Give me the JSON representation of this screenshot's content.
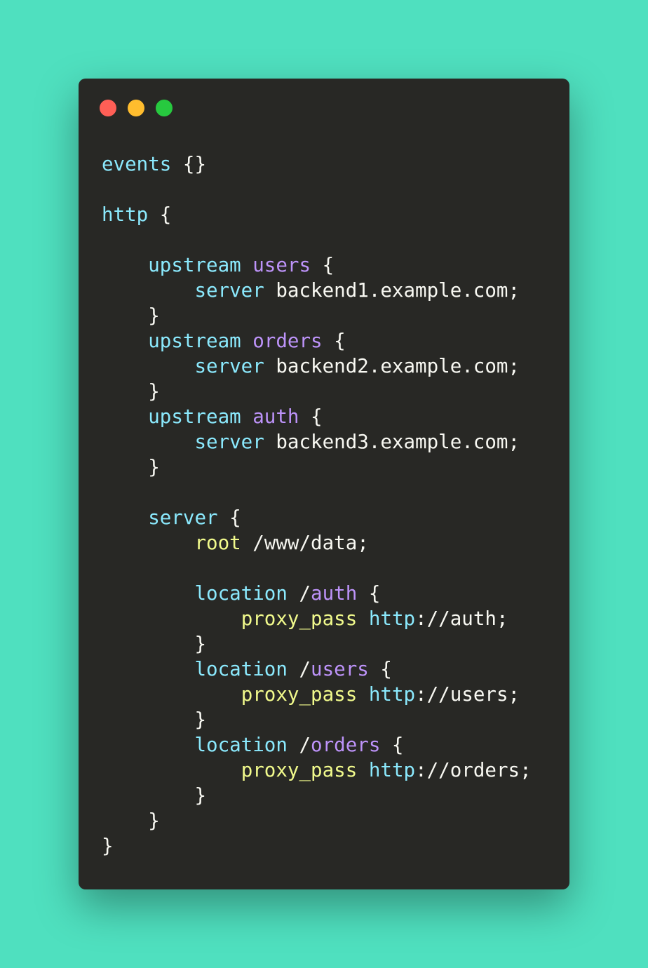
{
  "window": {
    "controls": [
      {
        "name": "close",
        "color": "#ff5f56"
      },
      {
        "name": "minimize",
        "color": "#ffbd2e"
      },
      {
        "name": "maximize",
        "color": "#27c93f"
      }
    ]
  },
  "colors": {
    "background": "#4fe0bf",
    "editor": "#282825",
    "keyword": "#8be9fd",
    "name": "#bd93f9",
    "directive": "#f1fa8c",
    "text": "#f8f8f2"
  },
  "code": {
    "language": "nginx",
    "lines": [
      [
        {
          "t": "events",
          "c": "kw"
        },
        {
          "t": " {}",
          "c": "tx"
        }
      ],
      [],
      [
        {
          "t": "http",
          "c": "kw"
        },
        {
          "t": " {",
          "c": "tx"
        }
      ],
      [],
      [
        {
          "t": "    ",
          "c": "tx"
        },
        {
          "t": "upstream",
          "c": "kw"
        },
        {
          "t": " ",
          "c": "tx"
        },
        {
          "t": "users",
          "c": "nm"
        },
        {
          "t": " {",
          "c": "tx"
        }
      ],
      [
        {
          "t": "        ",
          "c": "tx"
        },
        {
          "t": "server",
          "c": "kw"
        },
        {
          "t": " backend1.example.com;",
          "c": "tx"
        }
      ],
      [
        {
          "t": "    }",
          "c": "tx"
        }
      ],
      [
        {
          "t": "    ",
          "c": "tx"
        },
        {
          "t": "upstream",
          "c": "kw"
        },
        {
          "t": " ",
          "c": "tx"
        },
        {
          "t": "orders",
          "c": "nm"
        },
        {
          "t": " {",
          "c": "tx"
        }
      ],
      [
        {
          "t": "        ",
          "c": "tx"
        },
        {
          "t": "server",
          "c": "kw"
        },
        {
          "t": " backend2.example.com;",
          "c": "tx"
        }
      ],
      [
        {
          "t": "    }",
          "c": "tx"
        }
      ],
      [
        {
          "t": "    ",
          "c": "tx"
        },
        {
          "t": "upstream",
          "c": "kw"
        },
        {
          "t": " ",
          "c": "tx"
        },
        {
          "t": "auth",
          "c": "nm"
        },
        {
          "t": " {",
          "c": "tx"
        }
      ],
      [
        {
          "t": "        ",
          "c": "tx"
        },
        {
          "t": "server",
          "c": "kw"
        },
        {
          "t": " backend3.example.com;",
          "c": "tx"
        }
      ],
      [
        {
          "t": "    }",
          "c": "tx"
        }
      ],
      [],
      [
        {
          "t": "    ",
          "c": "tx"
        },
        {
          "t": "server",
          "c": "kw"
        },
        {
          "t": " {",
          "c": "tx"
        }
      ],
      [
        {
          "t": "        ",
          "c": "tx"
        },
        {
          "t": "root",
          "c": "fn"
        },
        {
          "t": " /www/data;",
          "c": "tx"
        }
      ],
      [],
      [
        {
          "t": "        ",
          "c": "tx"
        },
        {
          "t": "location",
          "c": "kw"
        },
        {
          "t": " /",
          "c": "tx"
        },
        {
          "t": "auth",
          "c": "nm"
        },
        {
          "t": " {",
          "c": "tx"
        }
      ],
      [
        {
          "t": "            ",
          "c": "tx"
        },
        {
          "t": "proxy_pass",
          "c": "fn"
        },
        {
          "t": " ",
          "c": "tx"
        },
        {
          "t": "http",
          "c": "kw"
        },
        {
          "t": "://auth;",
          "c": "tx"
        }
      ],
      [
        {
          "t": "        }",
          "c": "tx"
        }
      ],
      [
        {
          "t": "        ",
          "c": "tx"
        },
        {
          "t": "location",
          "c": "kw"
        },
        {
          "t": " /",
          "c": "tx"
        },
        {
          "t": "users",
          "c": "nm"
        },
        {
          "t": " {",
          "c": "tx"
        }
      ],
      [
        {
          "t": "            ",
          "c": "tx"
        },
        {
          "t": "proxy_pass",
          "c": "fn"
        },
        {
          "t": " ",
          "c": "tx"
        },
        {
          "t": "http",
          "c": "kw"
        },
        {
          "t": "://users;",
          "c": "tx"
        }
      ],
      [
        {
          "t": "        }",
          "c": "tx"
        }
      ],
      [
        {
          "t": "        ",
          "c": "tx"
        },
        {
          "t": "location",
          "c": "kw"
        },
        {
          "t": " /",
          "c": "tx"
        },
        {
          "t": "orders",
          "c": "nm"
        },
        {
          "t": " {",
          "c": "tx"
        }
      ],
      [
        {
          "t": "            ",
          "c": "tx"
        },
        {
          "t": "proxy_pass",
          "c": "fn"
        },
        {
          "t": " ",
          "c": "tx"
        },
        {
          "t": "http",
          "c": "kw"
        },
        {
          "t": "://orders;",
          "c": "tx"
        }
      ],
      [
        {
          "t": "        }",
          "c": "tx"
        }
      ],
      [
        {
          "t": "    }",
          "c": "tx"
        }
      ],
      [
        {
          "t": "}",
          "c": "tx"
        }
      ]
    ]
  }
}
